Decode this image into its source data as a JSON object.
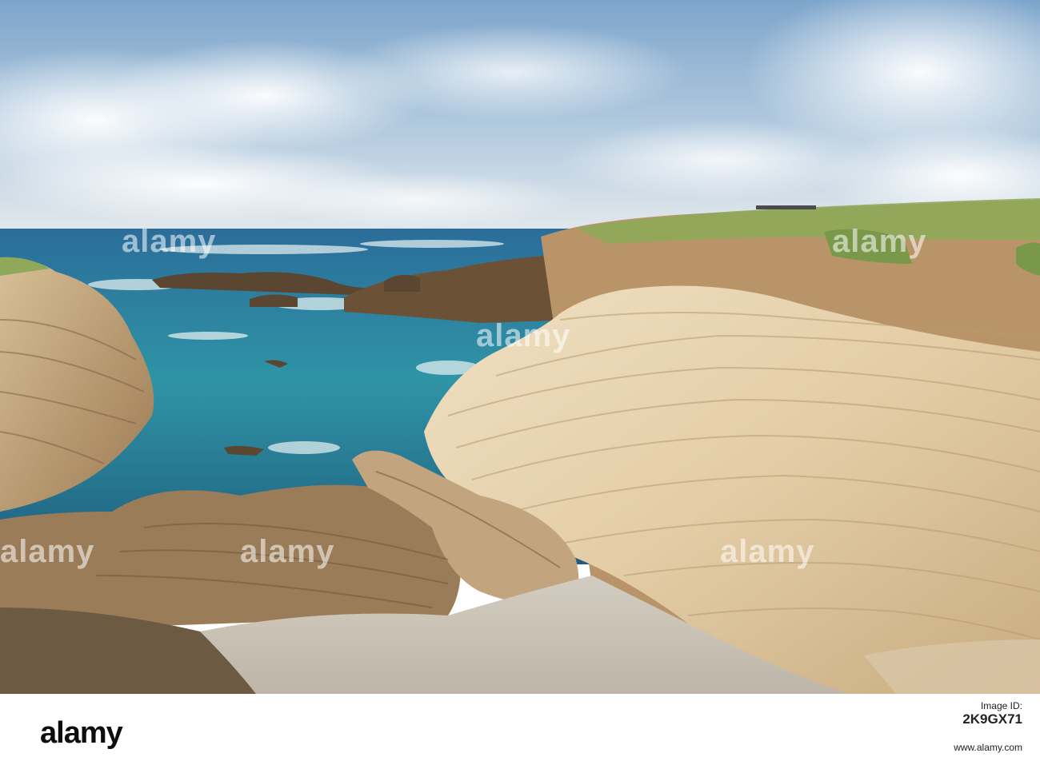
{
  "photo": {
    "subject": "rocky-coast-scene",
    "colors": {
      "sky_top": "#7fa6cc",
      "sky_horizon": "#dfe7ee",
      "ocean_deep": "#1f5a86",
      "ocean_teal": "#2fa3a6",
      "foam": "#e9f3f3",
      "rock_light": "#e6d2ae",
      "rock_shadow": "#a9865a",
      "rock_dark": "#5b4630",
      "grass": "#8fa85a",
      "gravel": "#cfc9bd"
    }
  },
  "watermark": {
    "text": "alamy"
  },
  "footer": {
    "brand": "alamy",
    "id_label": "Image ID:",
    "id_value": "2K9GX71",
    "url": "www.alamy.com"
  }
}
